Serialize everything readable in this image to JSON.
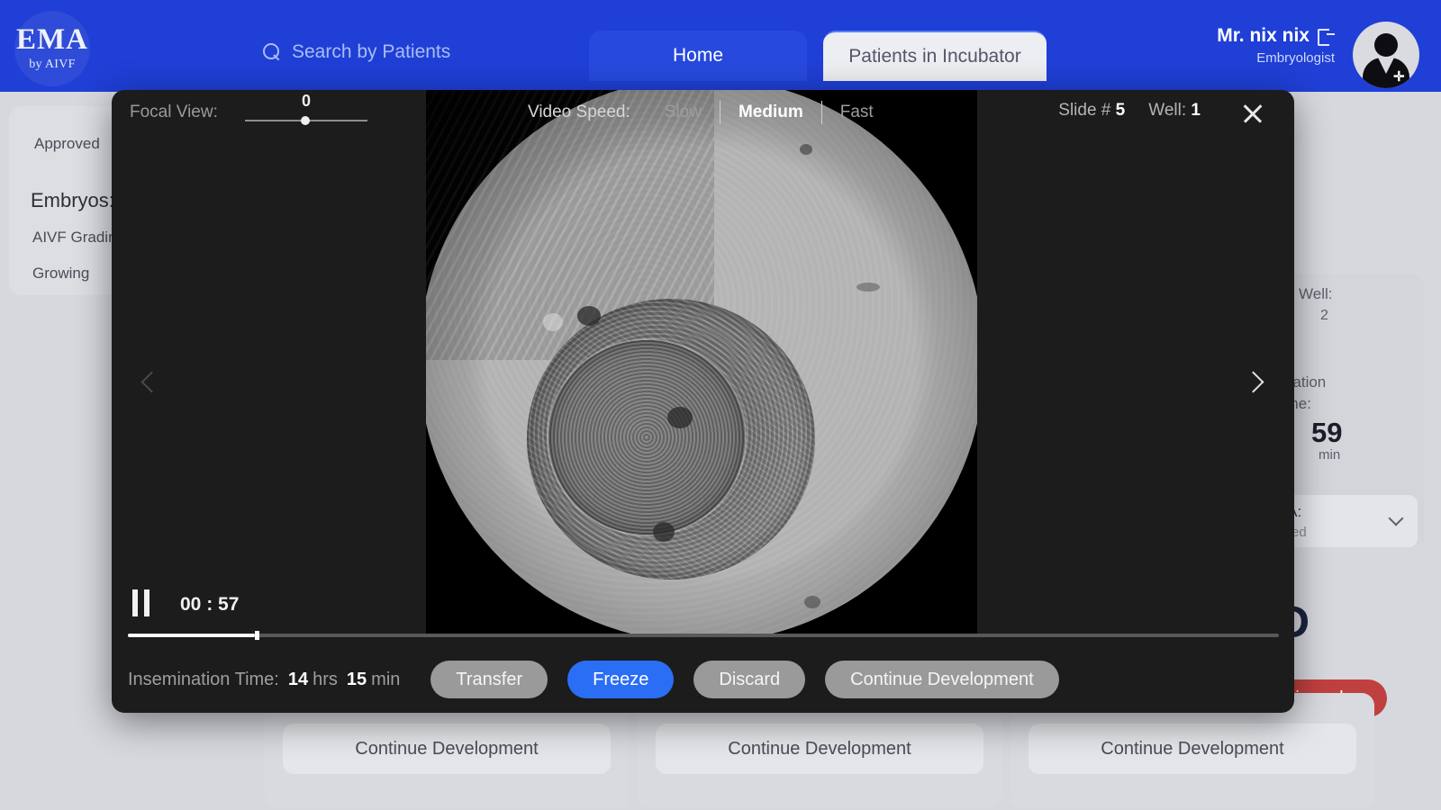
{
  "header": {
    "logo_main": "EMA",
    "logo_sub": "by AIVF",
    "search_placeholder": "Search by Patients",
    "tabs": [
      {
        "label": "Home",
        "active": false
      },
      {
        "label": "Patients in Incubator",
        "active": true
      }
    ],
    "user_name": "Mr. nix nix",
    "user_role": "Embryologist"
  },
  "background": {
    "left_card": {
      "approved": "Approved",
      "embryos_label": "Embryos:",
      "grading": "AIVF Grading",
      "growing": "Growing"
    },
    "right_card": {
      "dash": "#",
      "well_label": "Well:",
      "well_value": "2",
      "insemination_line1": "mination",
      "insemination_line2": "Time:",
      "value": "59",
      "unit": "min",
      "select_line1": "T-A:",
      "select_line2": "ested"
    },
    "big_letter": "D",
    "discard_label": "iscard",
    "bottom_cards": [
      {
        "continue_label": "Continue Development"
      },
      {
        "continue_label": "Continue Development"
      },
      {
        "continue_label": "Continue Development"
      }
    ]
  },
  "modal": {
    "focal_view_label": "Focal View:",
    "focal_view_value": "0",
    "video_speed_label": "Video Speed:",
    "video_speed_options": [
      {
        "label": "Slow",
        "active": false
      },
      {
        "label": "Medium",
        "active": true
      },
      {
        "label": "Fast",
        "active": false
      }
    ],
    "slide_label": "Slide #",
    "slide_value": "5",
    "well_label": "Well:",
    "well_value": "1",
    "playback": {
      "state": "paused",
      "time": "00 : 57",
      "progress_percent": 11
    },
    "insemination_time_label": "Insemination Time:",
    "insemination_hours": "14",
    "insemination_hours_unit": "hrs",
    "insemination_minutes": "15",
    "insemination_minutes_unit": "min",
    "actions": [
      {
        "label": "Transfer",
        "style": "gray"
      },
      {
        "label": "Freeze",
        "style": "blue"
      },
      {
        "label": "Discard",
        "style": "gray"
      },
      {
        "label": "Continue Development",
        "style": "gray"
      }
    ]
  },
  "colors": {
    "brand_blue": "#1f3fd6",
    "accent_blue": "#2b6ef6",
    "danger_red": "#c0403f",
    "modal_bg": "#1c1c1c"
  }
}
